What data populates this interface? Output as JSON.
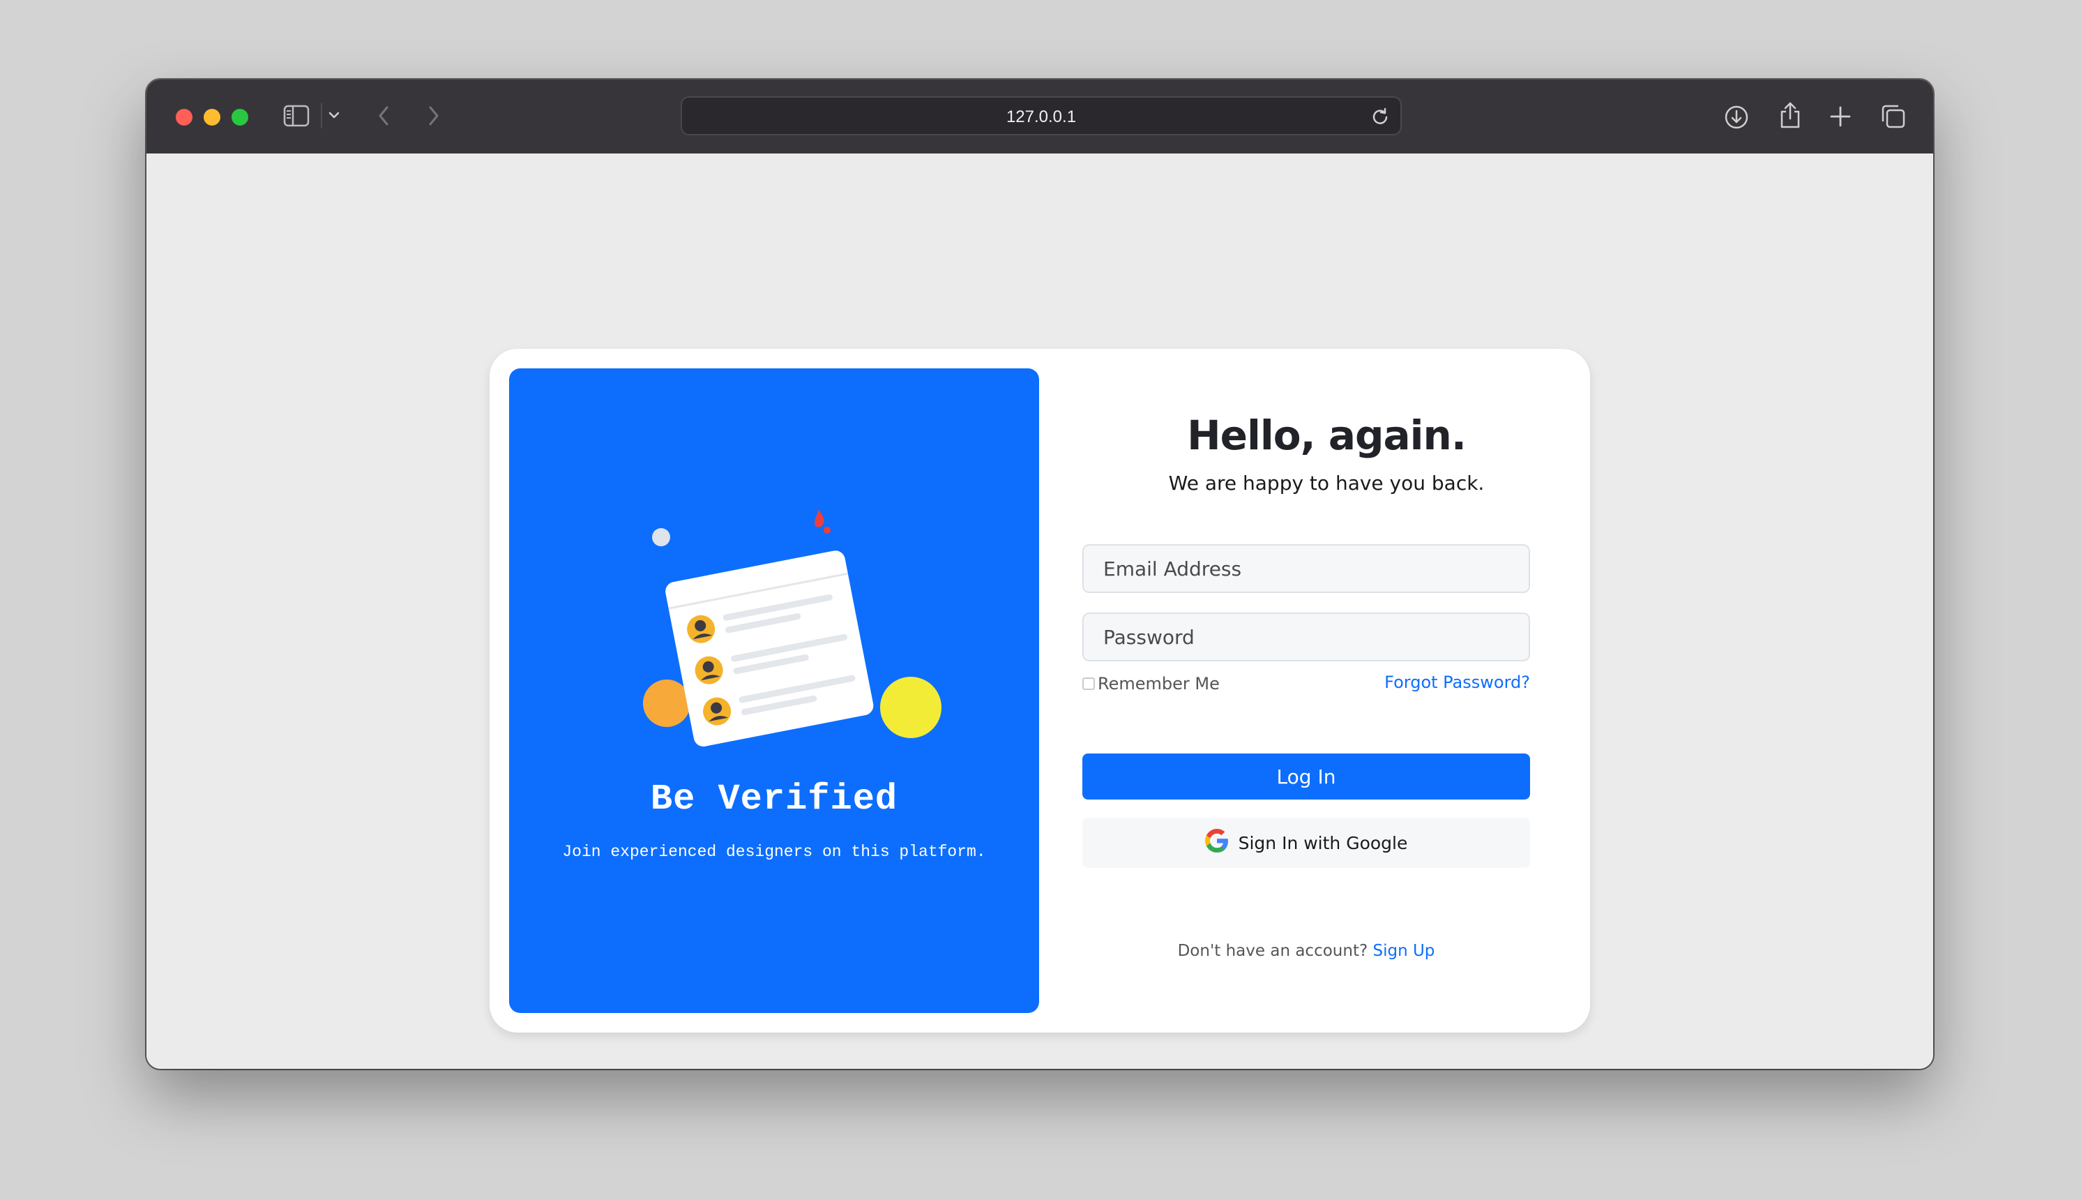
{
  "browser": {
    "url": "127.0.0.1",
    "icons": {
      "sidebar": "sidebar-icon",
      "chevron": "chevron-down-icon",
      "back": "back-arrow-icon",
      "forward": "forward-arrow-icon",
      "reload": "reload-icon",
      "download": "download-icon",
      "share": "share-icon",
      "new_tab": "plus-icon",
      "tabs": "tabs-overview-icon"
    }
  },
  "promo": {
    "title": "Be Verified",
    "subtitle": "Join experienced designers on this platform."
  },
  "login": {
    "heading": "Hello, again.",
    "subheading": "We are happy to have you back.",
    "email_placeholder": "Email Address",
    "password_placeholder": "Password",
    "remember_label": "Remember Me",
    "forgot_label": "Forgot Password?",
    "login_button": "Log In",
    "google_button": "Sign In with Google",
    "signup_prompt": "Don't have an account?",
    "signup_link": "Sign Up"
  },
  "colors": {
    "primary": "#0d6efd",
    "toolbar": "#37353a",
    "page_bg": "#ebebeb"
  }
}
